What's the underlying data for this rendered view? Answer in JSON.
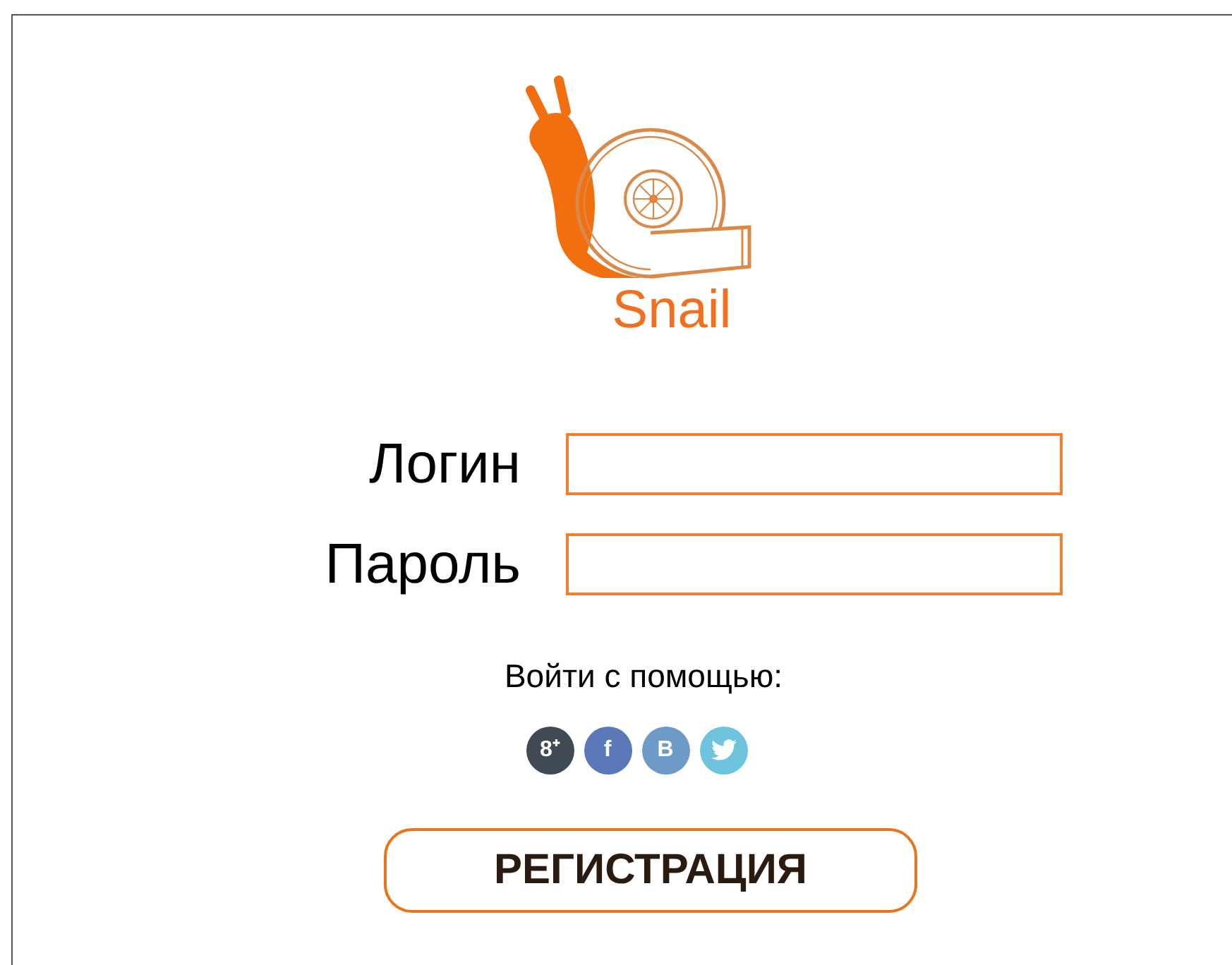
{
  "logo": {
    "name": "Snail"
  },
  "fields": [
    {
      "label": "Логин"
    },
    {
      "label": "Пароль"
    }
  ],
  "social": {
    "caption": "Войти с помощью:",
    "buttons": [
      {
        "kind": "gplus",
        "text": "8⁺",
        "color": "#3f4a55"
      },
      {
        "kind": "facebook",
        "text": "f",
        "color": "#5b79b8"
      },
      {
        "kind": "vk",
        "text": "B",
        "color": "#6d9ac6"
      },
      {
        "kind": "twitter",
        "color": "#6ec3dd"
      }
    ]
  },
  "register_button": {
    "label": "РЕГИСТРАЦИЯ"
  }
}
